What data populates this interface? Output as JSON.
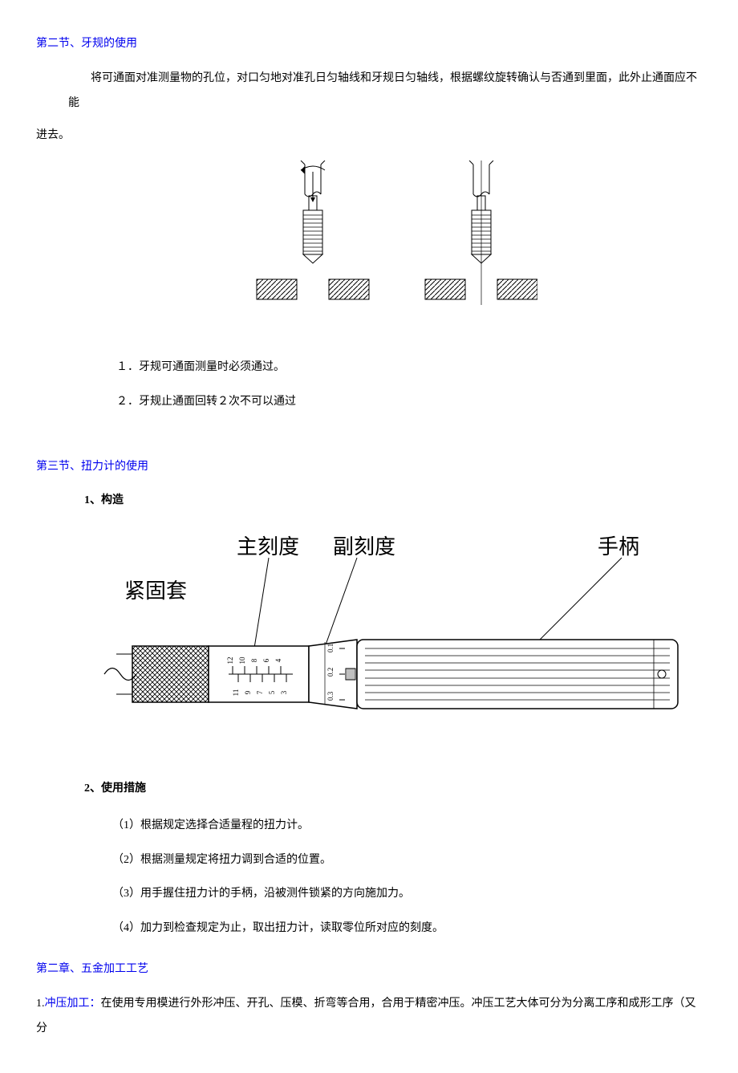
{
  "section2": {
    "title": "第二节、牙规的使用",
    "intro_prefix": "将可通面对准测量物的孔位，对口匀地对准孔日匀轴线和牙规日匀轴线，根据螺纹旋转确认与否通到里面，此外止通面应不能",
    "intro_suffix": "进去。",
    "item1": "１．牙规可通面测量时必须通过。",
    "item2": "２．牙规止通面回转２次不可以通过"
  },
  "section3": {
    "title": "第三节、扭力计的使用",
    "h_structure": "1、构造",
    "h_usage": "2、使用措施",
    "usage1": "（1）根据规定选择合适量程的扭力计。",
    "usage2": "（2）根据测量规定将扭力调到合适的位置。",
    "usage3": "（3）用手握住扭力计的手柄，沿被测件锁紧的方向施加力。",
    "usage4": "（4）加力到检查规定为止，取出扭力计，读取零位所对应的刻度。"
  },
  "chapter2": {
    "title": "第二章、五金加工工艺",
    "item1_no": "1.",
    "item1_term": "冲压加工：",
    "item1_body": "在使用专用模进行外形冲压、开孔、压模、折弯等合用，合用于精密冲压。冲压工艺大体可分为分离工序和成形工序（又分"
  },
  "torque_labels": {
    "fastener": "紧固套",
    "main_scale": "主刻度",
    "sub_scale": "副刻度",
    "handle": "手柄",
    "scale_even": [
      "12",
      "10",
      "8",
      "6",
      "4"
    ],
    "scale_odd": [
      "11",
      "9",
      "7",
      "5",
      "3"
    ],
    "side_scale": [
      "0.1",
      "0.2",
      "0.3"
    ]
  }
}
